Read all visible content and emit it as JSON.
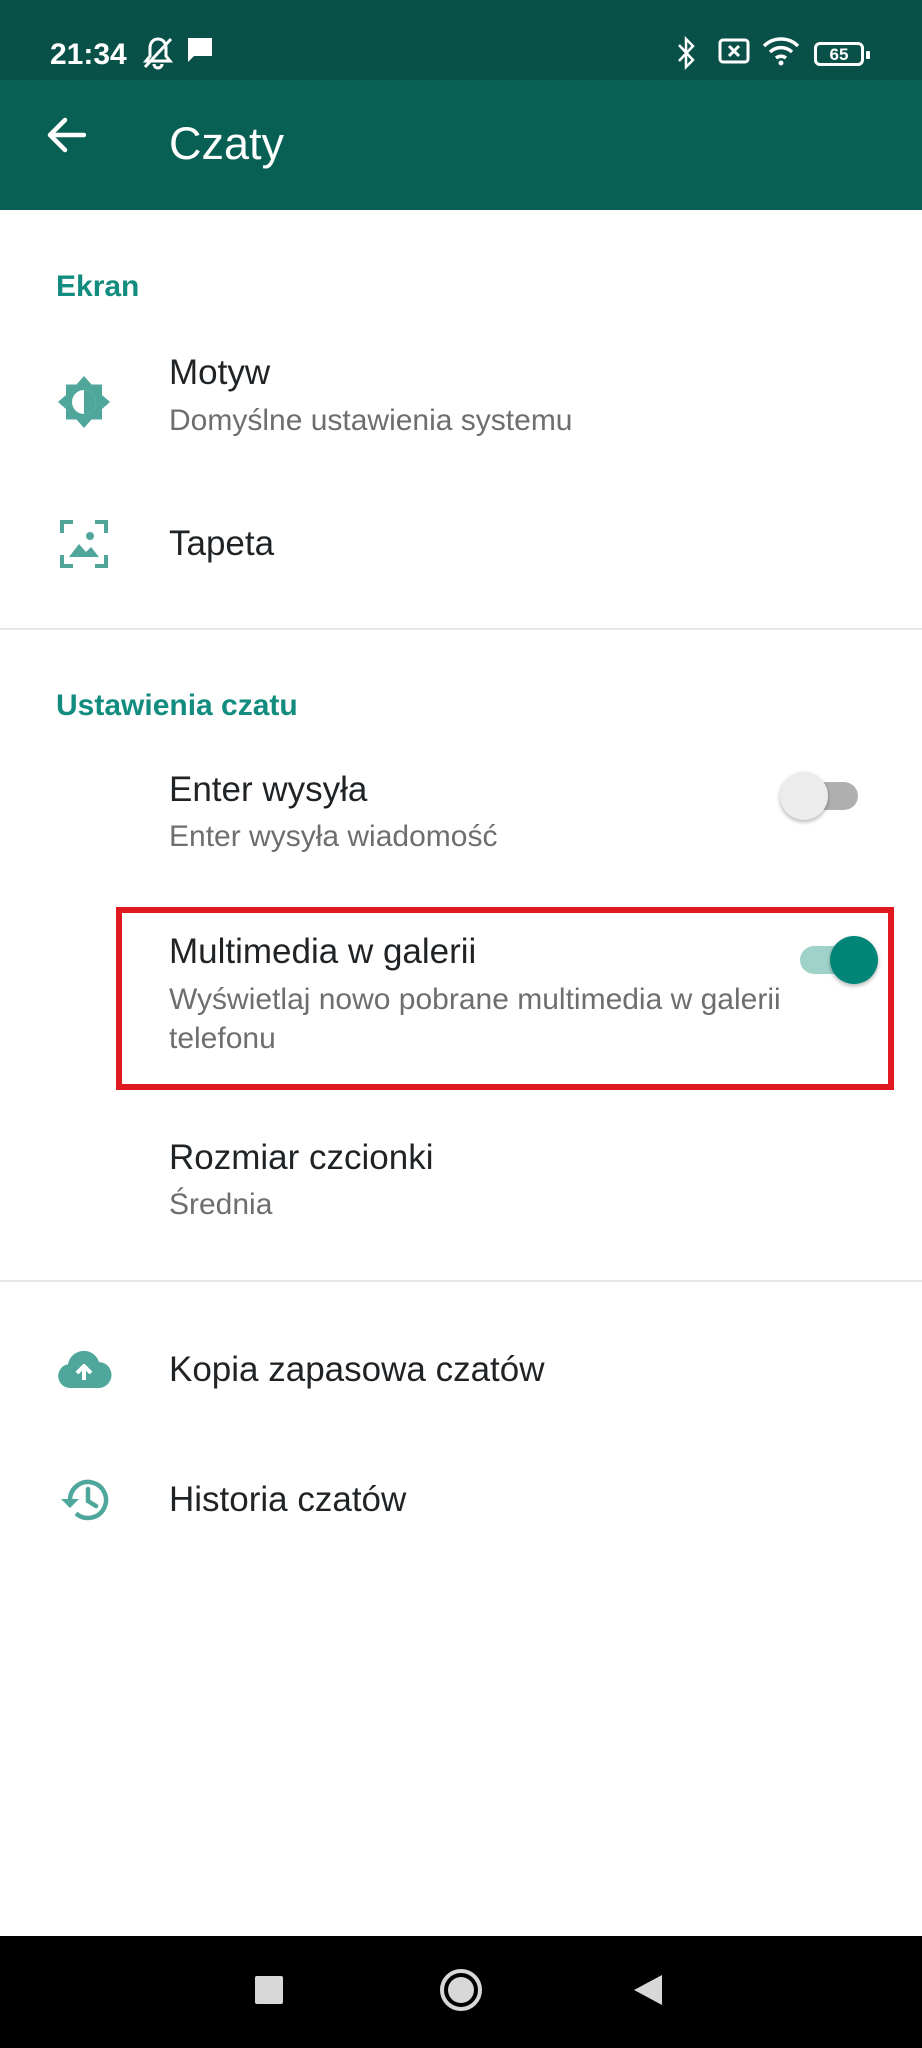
{
  "status_bar": {
    "time": "21:34",
    "battery": "65",
    "icons": [
      "bell-off-icon",
      "message-icon",
      "bluetooth-icon",
      "sim-off-icon",
      "wifi-icon",
      "battery-icon"
    ]
  },
  "app_bar": {
    "title": "Czaty",
    "back_icon": "arrow-back-icon",
    "background": "#085f54"
  },
  "sections": {
    "display": {
      "header": "Ekran",
      "theme": {
        "title": "Motyw",
        "subtitle": "Domyślne ustawienia systemu",
        "icon": "brightness-icon"
      },
      "wallpaper": {
        "title": "Tapeta",
        "icon": "wallpaper-icon"
      }
    },
    "chat_settings": {
      "header": "Ustawienia czatu",
      "enter_sends": {
        "title": "Enter wysyła",
        "subtitle": "Enter wysyła wiadomość",
        "enabled": false
      },
      "media_visibility": {
        "title": "Multimedia w galerii",
        "subtitle": "Wyświetlaj nowo pobrane multimedia w galerii telefonu",
        "enabled": true
      },
      "font_size": {
        "title": "Rozmiar czcionki",
        "subtitle": "Średnia"
      }
    },
    "other": {
      "backup": {
        "title": "Kopia zapasowa czatów",
        "icon": "cloud-upload-icon"
      },
      "history": {
        "title": "Historia czatów",
        "icon": "history-icon"
      }
    }
  },
  "colors": {
    "accent": "#128c7e",
    "toggle_on": "#008577",
    "highlight": "#e0181f"
  },
  "nav_bar": {
    "buttons": [
      "recents-square-icon",
      "home-circle-icon",
      "back-triangle-icon"
    ]
  }
}
